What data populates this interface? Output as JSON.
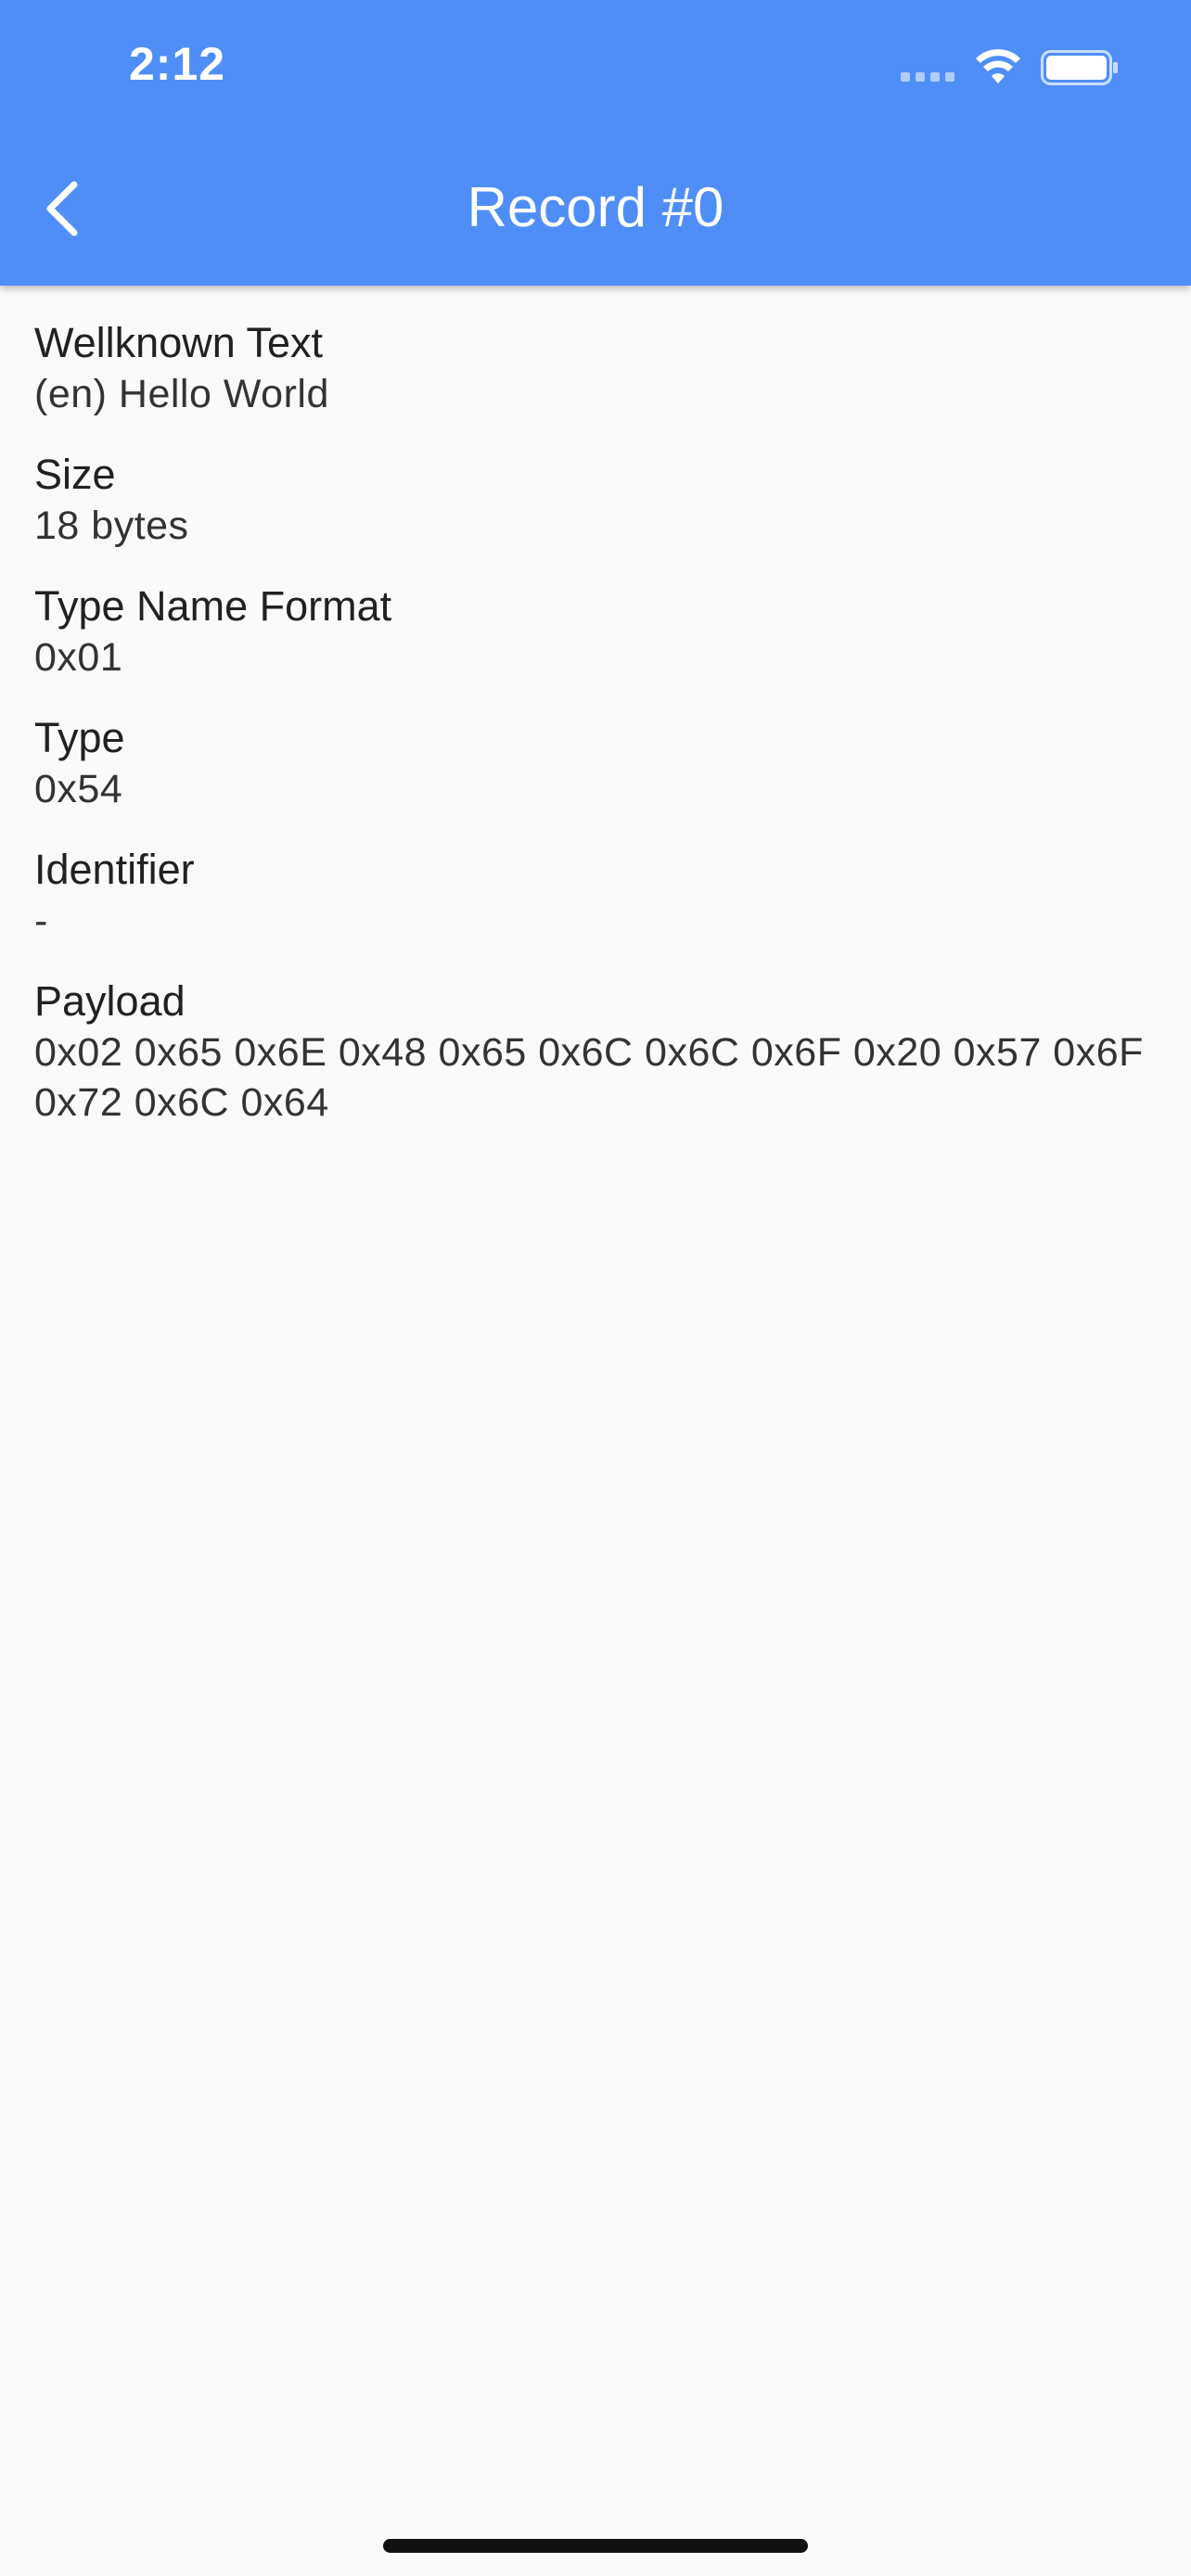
{
  "status_bar": {
    "time": "2:12"
  },
  "app_bar": {
    "title": "Record #0",
    "back_icon": "chevron-left-icon"
  },
  "colors": {
    "app_bar": "#4f8ef7",
    "background": "#fafafa",
    "text": "#212121"
  },
  "fields": [
    {
      "label": "Wellknown Text",
      "value": "(en) Hello World"
    },
    {
      "label": "Size",
      "value": "18 bytes"
    },
    {
      "label": "Type Name Format",
      "value": "0x01"
    },
    {
      "label": "Type",
      "value": "0x54"
    },
    {
      "label": "Identifier",
      "value": "-"
    },
    {
      "label": "Payload",
      "value": "0x02 0x65 0x6E 0x48 0x65 0x6C 0x6C 0x6F 0x20 0x57 0x6F 0x72 0x6C 0x64"
    }
  ]
}
